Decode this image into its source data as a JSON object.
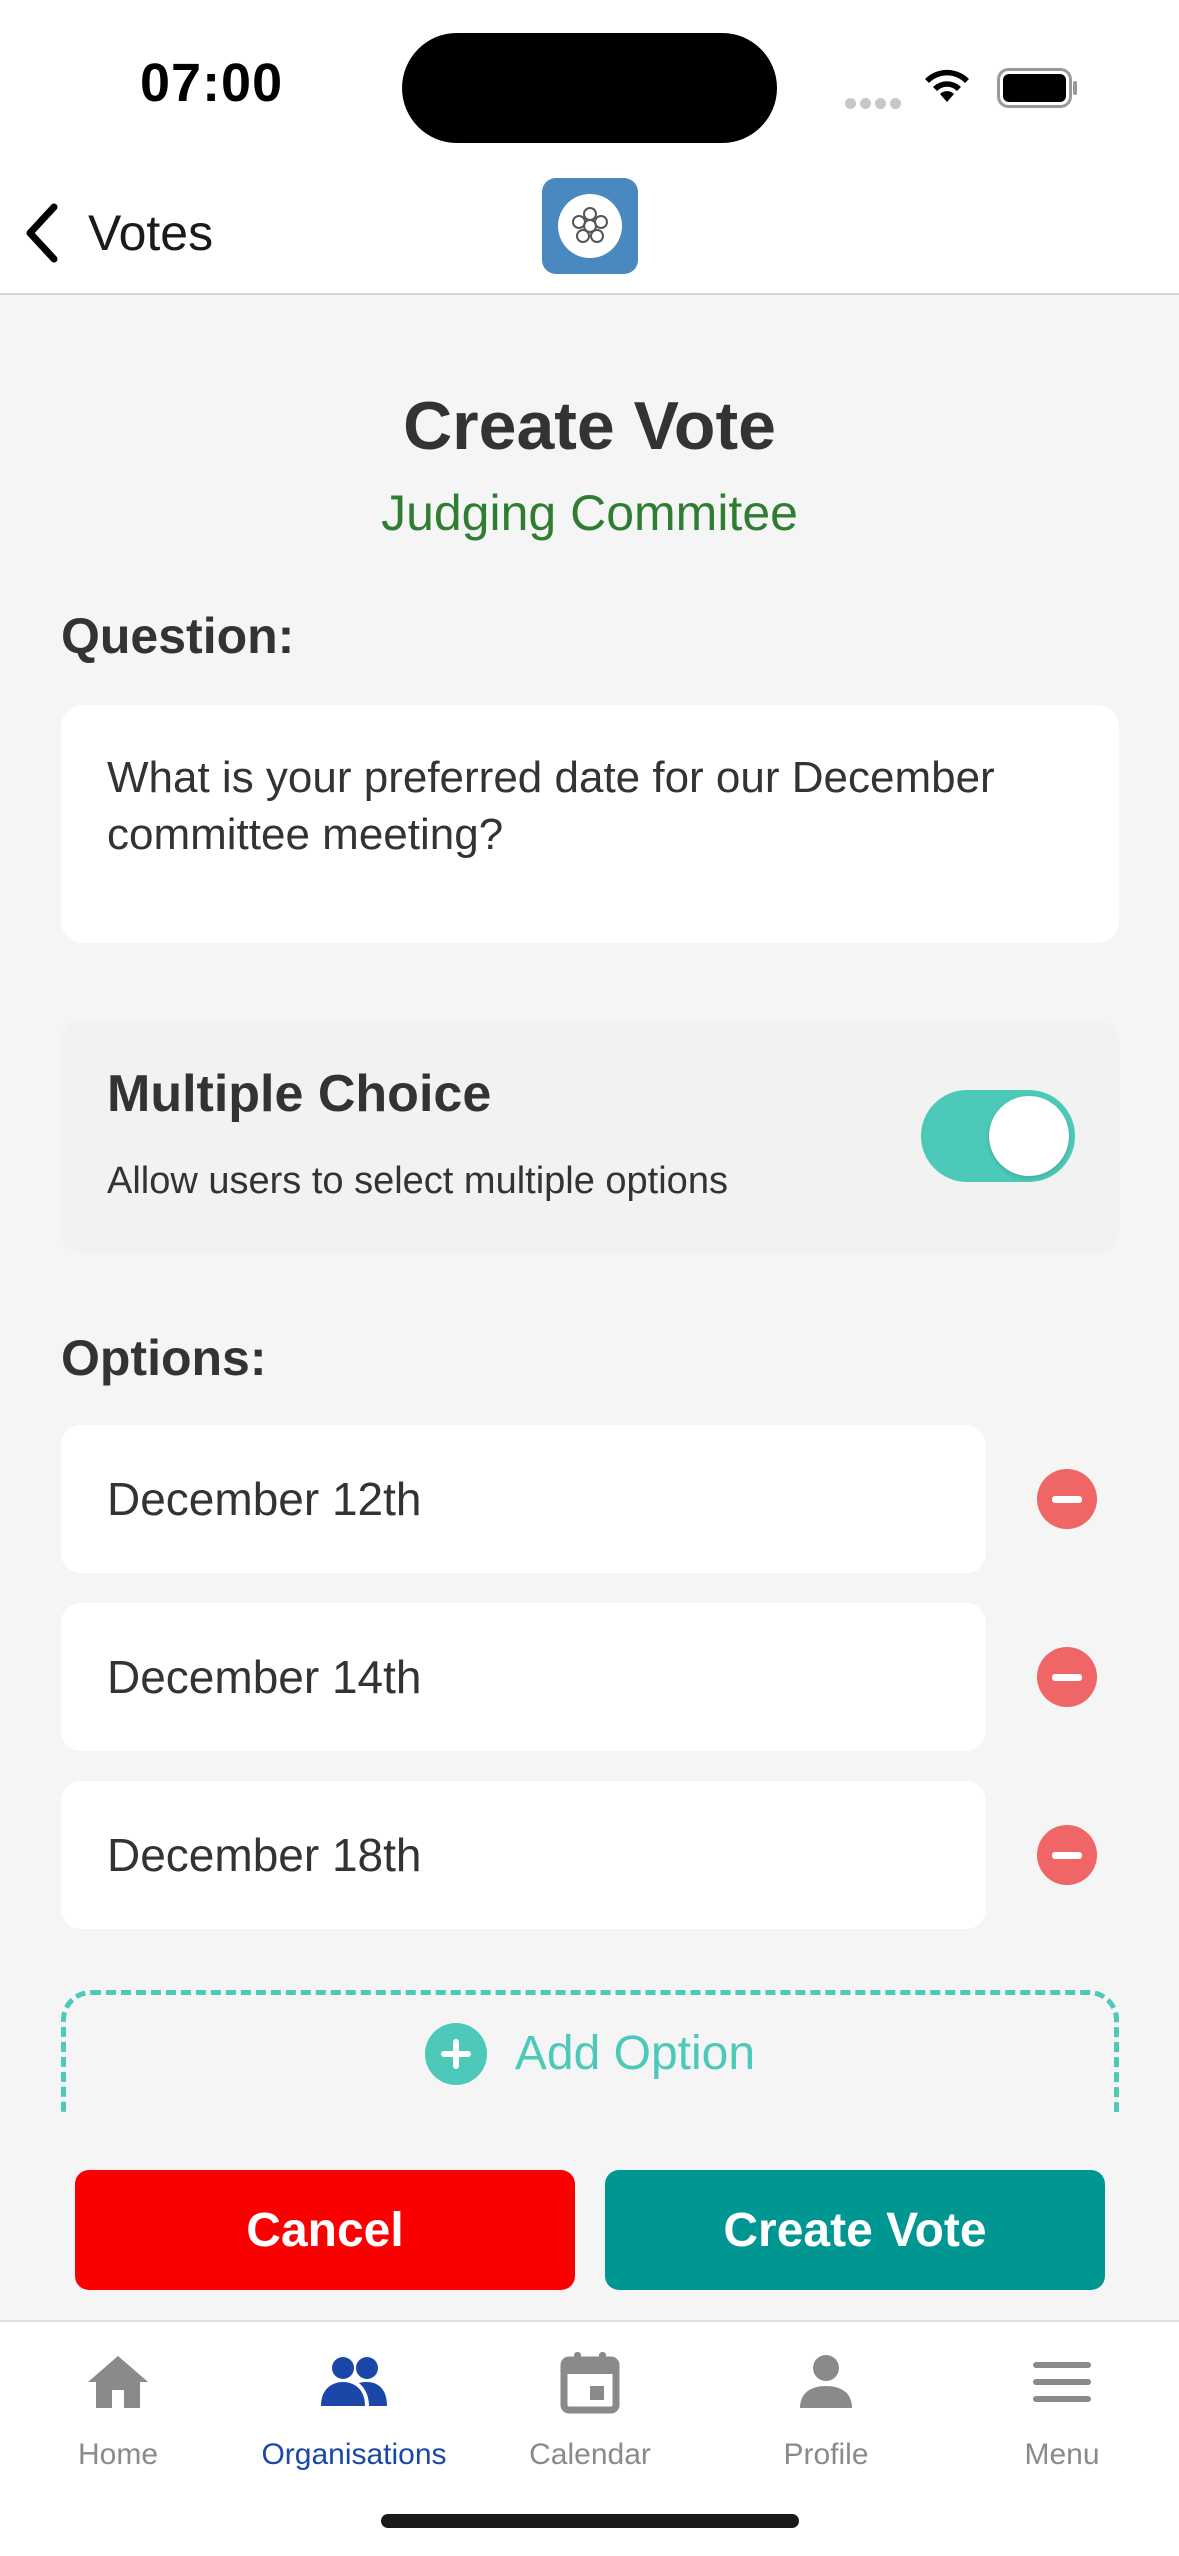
{
  "status_bar": {
    "time": "07:00"
  },
  "nav": {
    "back_label": "Votes"
  },
  "page": {
    "title": "Create Vote",
    "subtitle": "Judging Commitee"
  },
  "question": {
    "label": "Question:",
    "value": "What is your preferred date for our December committee meeting?"
  },
  "multiple_choice": {
    "title": "Multiple Choice",
    "description": "Allow users to select multiple options",
    "enabled": true
  },
  "options": {
    "label": "Options:",
    "items": [
      {
        "value": "December 12th"
      },
      {
        "value": "December 14th"
      },
      {
        "value": "December 18th"
      }
    ],
    "add_label": "Add Option"
  },
  "actions": {
    "cancel_label": "Cancel",
    "create_label": "Create Vote"
  },
  "tabs": [
    {
      "label": "Home",
      "icon": "home-icon",
      "active": false
    },
    {
      "label": "Organisations",
      "icon": "people-icon",
      "active": true
    },
    {
      "label": "Calendar",
      "icon": "calendar-icon",
      "active": false
    },
    {
      "label": "Profile",
      "icon": "person-icon",
      "active": false
    },
    {
      "label": "Menu",
      "icon": "menu-icon",
      "active": false
    }
  ],
  "colors": {
    "accent": "#4cc9b8",
    "subtitle": "#2e7d32",
    "cancel": "#fb0000",
    "create": "#009793",
    "remove": "#f06565",
    "active_tab": "#1a47a8"
  }
}
